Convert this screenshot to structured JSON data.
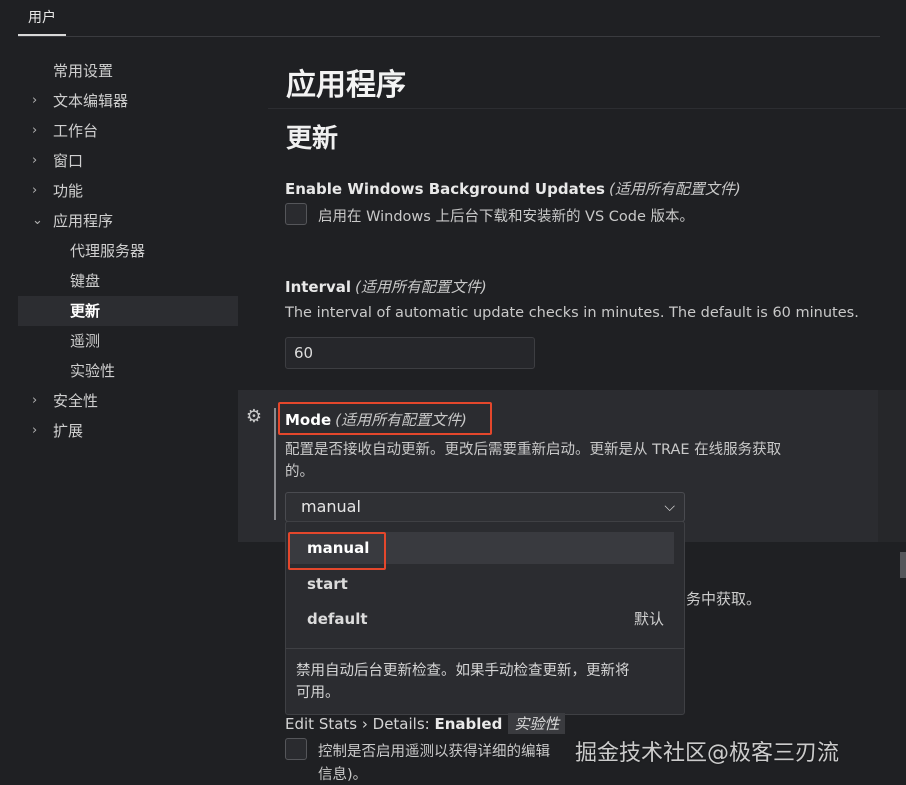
{
  "tabs": {
    "user": "用户"
  },
  "tree": [
    {
      "label": "常用设置",
      "level": 0,
      "chevron": false
    },
    {
      "label": "文本编辑器",
      "level": 0,
      "chevron": true
    },
    {
      "label": "工作台",
      "level": 0,
      "chevron": true
    },
    {
      "label": "窗口",
      "level": 0,
      "chevron": true
    },
    {
      "label": "功能",
      "level": 0,
      "chevron": true
    },
    {
      "label": "应用程序",
      "level": 0,
      "chevron": true,
      "expanded": true
    },
    {
      "label": "代理服务器",
      "level": 1
    },
    {
      "label": "键盘",
      "level": 1
    },
    {
      "label": "更新",
      "level": 1,
      "selected": true
    },
    {
      "label": "遥测",
      "level": 1
    },
    {
      "label": "实验性",
      "level": 1
    },
    {
      "label": "安全性",
      "level": 0,
      "chevron": true
    },
    {
      "label": "扩展",
      "level": 0,
      "chevron": true
    }
  ],
  "main": {
    "h1": "应用程序",
    "h2": "更新",
    "bg_updates": {
      "title": "Enable Windows Background Updates",
      "scope": "(适用所有配置文件)",
      "desc": "启用在 Windows 上后台下载和安装新的 VS Code 版本。",
      "checked": false
    },
    "interval": {
      "title": "Interval",
      "scope": "(适用所有配置文件)",
      "desc": "The interval of automatic update checks in minutes. The default is 60 minutes.",
      "value": "60"
    },
    "mode": {
      "title": "Mode",
      "scope": "(适用所有配置文件)",
      "desc_line1": "配置是否接收自动更新。更改后需要重新启动。更新是从 TRAE 在线服务获取",
      "desc_line2": "的。",
      "selected": "manual",
      "options": [
        "manual",
        "start",
        "default"
      ],
      "default_tag": "默认",
      "option_desc_line1": "禁用自动后台更新检查。如果手动检查更新，更新将",
      "option_desc_line2": "可用。"
    },
    "behind_text": "务中获取。",
    "edit_stats": {
      "title": "Edit Stats › Details: ",
      "value": "Enabled",
      "badge": "实验性",
      "desc_line1": "控制是否启用遥测以获得详细的编辑",
      "desc_line2": "信息)。"
    }
  },
  "watermark": "掘金技术社区@极客三刃流",
  "colors": {
    "highlight": "#e4472c",
    "background": "#1f2023",
    "panel": "#2b2c30"
  }
}
